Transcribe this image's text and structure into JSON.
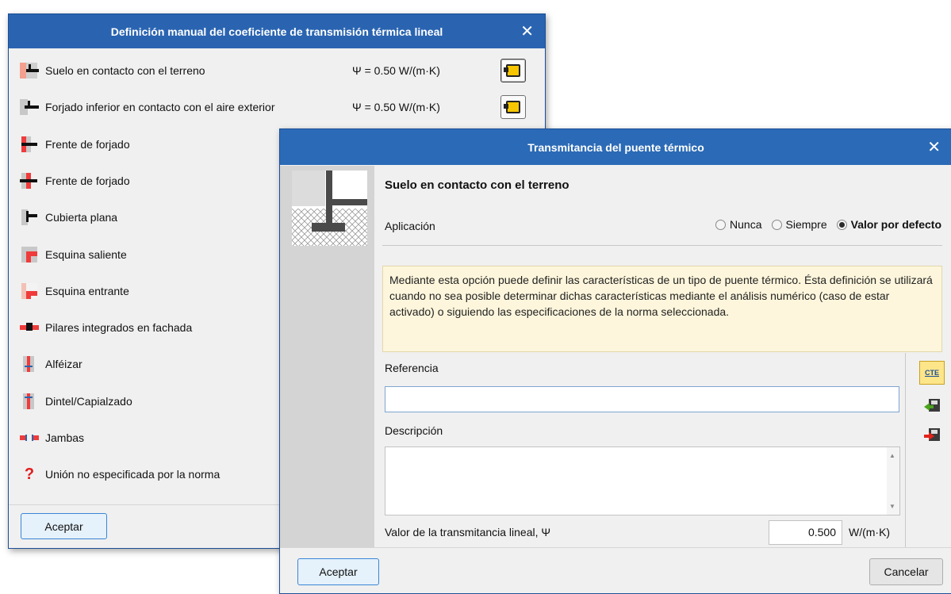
{
  "dialog1": {
    "title": "Definición manual del coeficiente de transmisión térmica lineal",
    "items": [
      {
        "label": "Suelo en contacto con el terreno",
        "psi": "Ψ = 0.50 W/(m·K)",
        "icon": "floor-ground-junction-icon"
      },
      {
        "label": "Forjado inferior en contacto con el aire exterior",
        "psi": "Ψ = 0.50 W/(m·K)",
        "icon": "floor-air-junction-icon"
      },
      {
        "label": "Frente de forjado",
        "icon": "slab-edge-junction-icon"
      },
      {
        "label": "Frente de forjado",
        "icon": "slab-edge-junction-icon"
      },
      {
        "label": "Cubierta plana",
        "icon": "flat-roof-junction-icon"
      },
      {
        "label": "Esquina saliente",
        "icon": "outer-corner-junction-icon"
      },
      {
        "label": "Esquina entrante",
        "icon": "inner-corner-junction-icon"
      },
      {
        "label": "Pilares integrados en fachada",
        "icon": "facade-pillar-junction-icon"
      },
      {
        "label": "Alféizar",
        "icon": "sill-junction-icon"
      },
      {
        "label": "Dintel/Capialzado",
        "icon": "lintel-junction-icon"
      },
      {
        "label": "Jambas",
        "icon": "jamb-junction-icon"
      },
      {
        "label": "Unión no especificada por la norma",
        "icon": "question-icon"
      }
    ],
    "accept_label": "Aceptar"
  },
  "dialog2": {
    "title": "Transmitancia del puente térmico",
    "heading": "Suelo en contacto con el terreno",
    "application_label": "Aplicación",
    "radio_options": [
      "Nunca",
      "Siempre",
      "Valor por defecto"
    ],
    "selected_option": "Valor por defecto",
    "info_text": "Mediante esta opción puede definir las características de un tipo de puente térmico. Ésta definición se utilizará cuando no sea posible determinar dichas características mediante el análisis numérico (caso de estar activado) o siguiendo las especificaciones de la norma seleccionada.",
    "reference_label": "Referencia",
    "reference_value": "",
    "description_label": "Descripción",
    "description_value": "",
    "transmittance_label": "Valor de la transmitancia lineal, Ψ",
    "transmittance_value": "0.500",
    "transmittance_unit": "W/(m·K)",
    "cte_label": "CTE",
    "accept_label": "Aceptar",
    "cancel_label": "Cancelar"
  },
  "colors": {
    "titlebar": "#2a64b1",
    "junction_red": "#ef3b3b",
    "info_bg": "#fdf6dc"
  }
}
